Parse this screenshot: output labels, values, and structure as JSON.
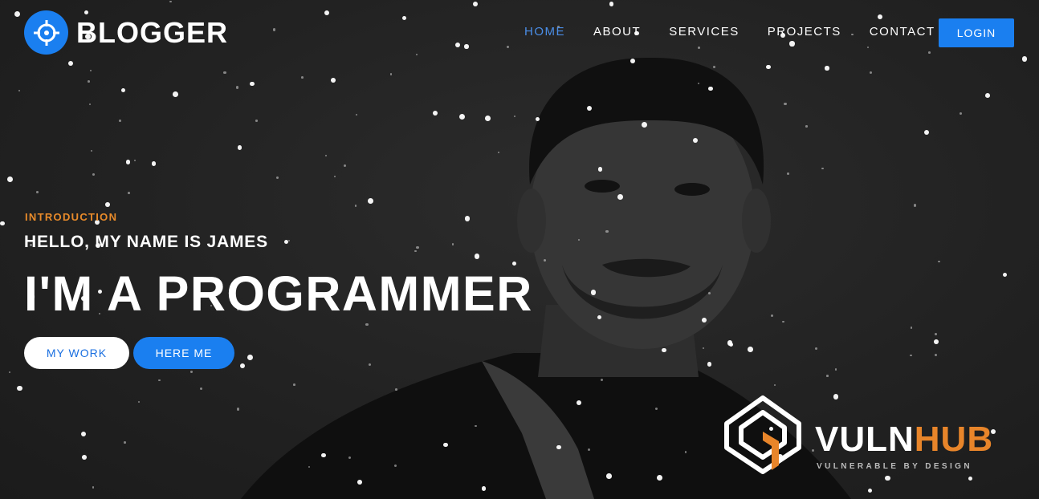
{
  "brand": {
    "name": "BLOGGER",
    "icon": "crosshair-icon"
  },
  "nav": {
    "items": [
      {
        "label": "HOME",
        "active": true
      },
      {
        "label": "ABOUT"
      },
      {
        "label": "SERVICES"
      },
      {
        "label": "PROJECTS"
      },
      {
        "label": "CONTACT"
      }
    ],
    "login_label": "LOGIN"
  },
  "hero": {
    "intro": "INTRODUCTION",
    "greeting": "HELLO, MY NAME IS JAMES",
    "headline": "I'M A PROGRAMMER",
    "buttons": {
      "my_work": "MY WORK",
      "here_me": "HERE ME"
    }
  },
  "watermark": {
    "word_a": "VULN",
    "word_b": "HUB",
    "tagline": "VULNERABLE BY DESIGN"
  },
  "colors": {
    "accent": "#1a7ff0",
    "intro": "#e98b2a",
    "hub": "#e8852a",
    "active_nav": "#4a8ee8"
  }
}
